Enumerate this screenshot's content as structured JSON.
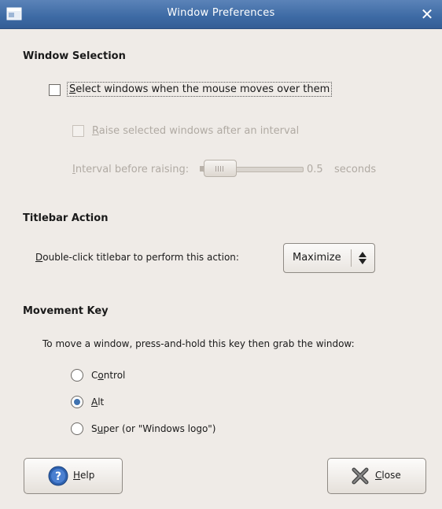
{
  "window": {
    "title": "Window Preferences",
    "close_glyph": "✕",
    "icon": "window-icon"
  },
  "selection": {
    "heading": "Window Selection",
    "focus_check": {
      "mnemonic": "S",
      "rest": "elect windows when the mouse moves over them",
      "checked": false
    },
    "raise_check": {
      "mnemonic": "R",
      "rest": "aise selected windows after an interval",
      "checked": false,
      "enabled": false
    },
    "interval": {
      "mnemonic": "I",
      "rest": "nterval before raising:",
      "value_text": "0.5",
      "unit": "seconds",
      "value": 0.5,
      "enabled": false
    }
  },
  "titlebar_action": {
    "heading": "Titlebar Action",
    "label_mnemonic": "D",
    "label_rest": "ouble-click titlebar to perform this action:",
    "selected": "Maximize"
  },
  "movement": {
    "heading": "Movement Key",
    "instruction": "To move a window, press-and-hold this key then grab the window:",
    "options": [
      {
        "pre": "C",
        "mnemonic": "o",
        "post": "ntrol",
        "checked": false
      },
      {
        "pre": "",
        "mnemonic": "A",
        "post": "lt",
        "checked": true
      },
      {
        "pre": "S",
        "mnemonic": "u",
        "post": "per (or \"Windows logo\")",
        "checked": false
      }
    ]
  },
  "buttons": {
    "help": {
      "mnemonic": "H",
      "rest": "elp",
      "icon": "help-icon"
    },
    "close": {
      "mnemonic": "C",
      "rest": "lose",
      "icon": "close-x-icon"
    }
  },
  "colors": {
    "titlebar": "#3d6aa4",
    "background": "#efebe7",
    "radio_accent": "#3f72b0"
  }
}
